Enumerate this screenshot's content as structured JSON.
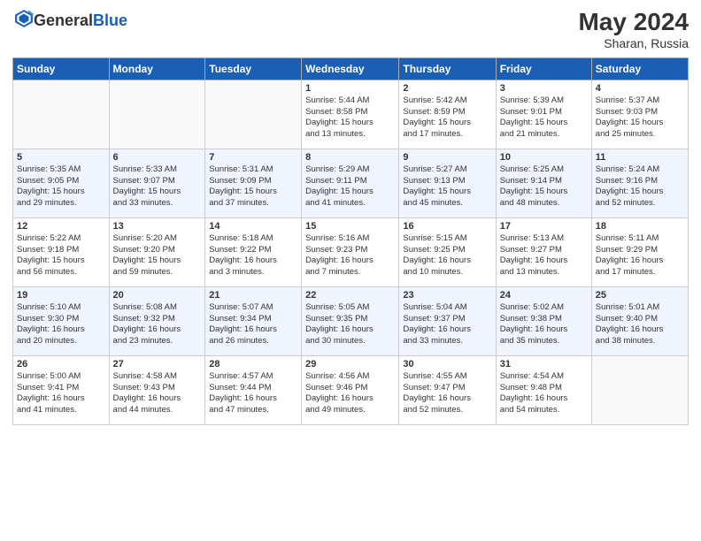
{
  "header": {
    "logo_general": "General",
    "logo_blue": "Blue",
    "month_title": "May 2024",
    "location": "Sharan, Russia"
  },
  "days_of_week": [
    "Sunday",
    "Monday",
    "Tuesday",
    "Wednesday",
    "Thursday",
    "Friday",
    "Saturday"
  ],
  "weeks": [
    [
      {
        "day": "",
        "info": ""
      },
      {
        "day": "",
        "info": ""
      },
      {
        "day": "",
        "info": ""
      },
      {
        "day": "1",
        "info": "Sunrise: 5:44 AM\nSunset: 8:58 PM\nDaylight: 15 hours\nand 13 minutes."
      },
      {
        "day": "2",
        "info": "Sunrise: 5:42 AM\nSunset: 8:59 PM\nDaylight: 15 hours\nand 17 minutes."
      },
      {
        "day": "3",
        "info": "Sunrise: 5:39 AM\nSunset: 9:01 PM\nDaylight: 15 hours\nand 21 minutes."
      },
      {
        "day": "4",
        "info": "Sunrise: 5:37 AM\nSunset: 9:03 PM\nDaylight: 15 hours\nand 25 minutes."
      }
    ],
    [
      {
        "day": "5",
        "info": "Sunrise: 5:35 AM\nSunset: 9:05 PM\nDaylight: 15 hours\nand 29 minutes."
      },
      {
        "day": "6",
        "info": "Sunrise: 5:33 AM\nSunset: 9:07 PM\nDaylight: 15 hours\nand 33 minutes."
      },
      {
        "day": "7",
        "info": "Sunrise: 5:31 AM\nSunset: 9:09 PM\nDaylight: 15 hours\nand 37 minutes."
      },
      {
        "day": "8",
        "info": "Sunrise: 5:29 AM\nSunset: 9:11 PM\nDaylight: 15 hours\nand 41 minutes."
      },
      {
        "day": "9",
        "info": "Sunrise: 5:27 AM\nSunset: 9:13 PM\nDaylight: 15 hours\nand 45 minutes."
      },
      {
        "day": "10",
        "info": "Sunrise: 5:25 AM\nSunset: 9:14 PM\nDaylight: 15 hours\nand 48 minutes."
      },
      {
        "day": "11",
        "info": "Sunrise: 5:24 AM\nSunset: 9:16 PM\nDaylight: 15 hours\nand 52 minutes."
      }
    ],
    [
      {
        "day": "12",
        "info": "Sunrise: 5:22 AM\nSunset: 9:18 PM\nDaylight: 15 hours\nand 56 minutes."
      },
      {
        "day": "13",
        "info": "Sunrise: 5:20 AM\nSunset: 9:20 PM\nDaylight: 15 hours\nand 59 minutes."
      },
      {
        "day": "14",
        "info": "Sunrise: 5:18 AM\nSunset: 9:22 PM\nDaylight: 16 hours\nand 3 minutes."
      },
      {
        "day": "15",
        "info": "Sunrise: 5:16 AM\nSunset: 9:23 PM\nDaylight: 16 hours\nand 7 minutes."
      },
      {
        "day": "16",
        "info": "Sunrise: 5:15 AM\nSunset: 9:25 PM\nDaylight: 16 hours\nand 10 minutes."
      },
      {
        "day": "17",
        "info": "Sunrise: 5:13 AM\nSunset: 9:27 PM\nDaylight: 16 hours\nand 13 minutes."
      },
      {
        "day": "18",
        "info": "Sunrise: 5:11 AM\nSunset: 9:29 PM\nDaylight: 16 hours\nand 17 minutes."
      }
    ],
    [
      {
        "day": "19",
        "info": "Sunrise: 5:10 AM\nSunset: 9:30 PM\nDaylight: 16 hours\nand 20 minutes."
      },
      {
        "day": "20",
        "info": "Sunrise: 5:08 AM\nSunset: 9:32 PM\nDaylight: 16 hours\nand 23 minutes."
      },
      {
        "day": "21",
        "info": "Sunrise: 5:07 AM\nSunset: 9:34 PM\nDaylight: 16 hours\nand 26 minutes."
      },
      {
        "day": "22",
        "info": "Sunrise: 5:05 AM\nSunset: 9:35 PM\nDaylight: 16 hours\nand 30 minutes."
      },
      {
        "day": "23",
        "info": "Sunrise: 5:04 AM\nSunset: 9:37 PM\nDaylight: 16 hours\nand 33 minutes."
      },
      {
        "day": "24",
        "info": "Sunrise: 5:02 AM\nSunset: 9:38 PM\nDaylight: 16 hours\nand 35 minutes."
      },
      {
        "day": "25",
        "info": "Sunrise: 5:01 AM\nSunset: 9:40 PM\nDaylight: 16 hours\nand 38 minutes."
      }
    ],
    [
      {
        "day": "26",
        "info": "Sunrise: 5:00 AM\nSunset: 9:41 PM\nDaylight: 16 hours\nand 41 minutes."
      },
      {
        "day": "27",
        "info": "Sunrise: 4:58 AM\nSunset: 9:43 PM\nDaylight: 16 hours\nand 44 minutes."
      },
      {
        "day": "28",
        "info": "Sunrise: 4:57 AM\nSunset: 9:44 PM\nDaylight: 16 hours\nand 47 minutes."
      },
      {
        "day": "29",
        "info": "Sunrise: 4:56 AM\nSunset: 9:46 PM\nDaylight: 16 hours\nand 49 minutes."
      },
      {
        "day": "30",
        "info": "Sunrise: 4:55 AM\nSunset: 9:47 PM\nDaylight: 16 hours\nand 52 minutes."
      },
      {
        "day": "31",
        "info": "Sunrise: 4:54 AM\nSunset: 9:48 PM\nDaylight: 16 hours\nand 54 minutes."
      },
      {
        "day": "",
        "info": ""
      }
    ]
  ]
}
